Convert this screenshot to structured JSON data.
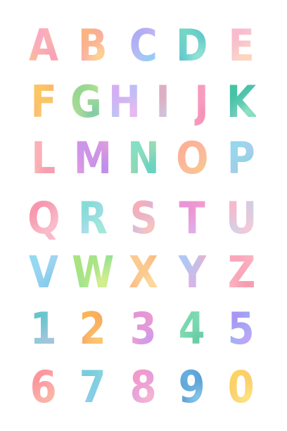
{
  "characters": [
    {
      "char": "A",
      "colors": [
        "#f7a1c4",
        "#f9c38a",
        "#f59bb7"
      ]
    },
    {
      "char": "B",
      "colors": [
        "#f8b07a",
        "#f6a0b0",
        "#fbd08a"
      ]
    },
    {
      "char": "C",
      "colors": [
        "#a8a6f0",
        "#c9b3f2",
        "#8fc8f4"
      ]
    },
    {
      "char": "D",
      "colors": [
        "#6fd3c2",
        "#47b8c8",
        "#8fe0d0"
      ]
    },
    {
      "char": "E",
      "colors": [
        "#f6b7c8",
        "#f4c8d6",
        "#fbd3b8"
      ]
    },
    {
      "char": "F",
      "colors": [
        "#f8c45c",
        "#f7a86a",
        "#fbd46a"
      ]
    },
    {
      "char": "G",
      "colors": [
        "#8fd28a",
        "#bfe58e",
        "#7cc7a0"
      ]
    },
    {
      "char": "H",
      "colors": [
        "#d4a8f0",
        "#a9c4f4",
        "#e7b4ec"
      ]
    },
    {
      "char": "I",
      "colors": [
        "#d7a9c0",
        "#f0a8b4",
        "#c7c0d8"
      ]
    },
    {
      "char": "J",
      "colors": [
        "#f392b6",
        "#f7a8c6",
        "#f188b0"
      ]
    },
    {
      "char": "K",
      "colors": [
        "#3bbf9e",
        "#4fb6b0",
        "#8adfc0"
      ]
    },
    {
      "char": "L",
      "colors": [
        "#f9a9b4",
        "#fbc3b4",
        "#f394aa"
      ]
    },
    {
      "char": "M",
      "colors": [
        "#c58ee6",
        "#e49ad6",
        "#b487e8"
      ]
    },
    {
      "char": "N",
      "colors": [
        "#7fdcc0",
        "#9fd8a8",
        "#5fcfbf"
      ]
    },
    {
      "char": "O",
      "colors": [
        "#f9ad8f",
        "#fbb59d",
        "#f6c08a"
      ]
    },
    {
      "char": "P",
      "colors": [
        "#8fd4e8",
        "#b4c8f0",
        "#7fd0d6"
      ]
    },
    {
      "char": "Q",
      "colors": [
        "#f38fa8",
        "#f5a9b8",
        "#f7b8c8"
      ]
    },
    {
      "char": "R",
      "colors": [
        "#7fdad0",
        "#a9d4f4",
        "#9ce7d6"
      ]
    },
    {
      "char": "S",
      "colors": [
        "#f6a8b0",
        "#c4b8e8",
        "#f7c0b8"
      ]
    },
    {
      "char": "T",
      "colors": [
        "#e58ed0",
        "#f49ac2",
        "#d8a8f0"
      ]
    },
    {
      "char": "U",
      "colors": [
        "#f6b4c8",
        "#b8d8f0",
        "#f4c4d4"
      ]
    },
    {
      "char": "V",
      "colors": [
        "#8fd6f0",
        "#a4ccf0",
        "#7fc8e8"
      ]
    },
    {
      "char": "W",
      "colors": [
        "#a8e07a",
        "#8fe08f",
        "#d4ec8a"
      ]
    },
    {
      "char": "X",
      "colors": [
        "#f9c88a",
        "#f7b07a",
        "#fbd89a"
      ]
    },
    {
      "char": "Y",
      "colors": [
        "#a9c4f4",
        "#f4a8c0",
        "#c6b4f0"
      ]
    },
    {
      "char": "Z",
      "colors": [
        "#f7a0b4",
        "#f9b8c4",
        "#f394a8"
      ]
    },
    {
      "char": "1",
      "colors": [
        "#5fbfc6",
        "#7fc8d8",
        "#9fc0d8"
      ]
    },
    {
      "char": "2",
      "colors": [
        "#f8b050",
        "#f49a5f",
        "#f8c46a"
      ]
    },
    {
      "char": "3",
      "colors": [
        "#e08ed4",
        "#f29ac4",
        "#c994e8"
      ]
    },
    {
      "char": "4",
      "colors": [
        "#6fd3a8",
        "#8fdfb8",
        "#5fc79f"
      ]
    },
    {
      "char": "5",
      "colors": [
        "#a48ef0",
        "#8fb4f0",
        "#b89ef2"
      ]
    },
    {
      "char": "6",
      "colors": [
        "#f88e96",
        "#f9a4a4",
        "#f7b0a0"
      ]
    },
    {
      "char": "7",
      "colors": [
        "#6fc8d8",
        "#8fd6e0",
        "#7fc4e8"
      ]
    },
    {
      "char": "8",
      "colors": [
        "#f094c4",
        "#d69ae0",
        "#f4b0cc"
      ]
    },
    {
      "char": "9",
      "colors": [
        "#5fa8d8",
        "#3f88c8",
        "#7fc0e4"
      ]
    },
    {
      "char": "0",
      "colors": [
        "#fbd05f",
        "#f8c46a",
        "#fbe07a"
      ]
    }
  ]
}
